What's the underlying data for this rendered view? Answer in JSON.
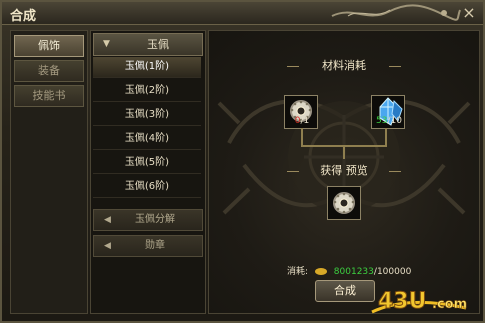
{
  "window": {
    "title": "合成",
    "close_icon": "close-icon"
  },
  "tabs": [
    {
      "label": "佩饰",
      "active": true
    },
    {
      "label": "装备",
      "active": false
    },
    {
      "label": "技能书",
      "active": false
    }
  ],
  "list": {
    "header": "玉佩",
    "items": [
      "玉佩(1阶)",
      "玉佩(2阶)",
      "玉佩(3阶)",
      "玉佩(4阶)",
      "玉佩(5阶)",
      "玉佩(6阶)"
    ],
    "subcategories": [
      "玉佩分解",
      "勋章"
    ]
  },
  "main": {
    "materials_title": "材料消耗",
    "material1": {
      "owned": "0",
      "required": "1",
      "owned_color": "#d12a22",
      "icon": "jade-pendant-icon"
    },
    "material2": {
      "owned": "53",
      "required": "10",
      "owned_color": "#3ccf40",
      "icon": "blue-crystal-icon"
    },
    "preview_title": "获得  预览",
    "result_icon": "jade-pendant-icon",
    "cost_label": "消耗:",
    "cost_current": "8001233",
    "cost_required": "100000",
    "button_label": "合成"
  },
  "logo": {
    "text": "43U",
    "domain": ".com"
  }
}
